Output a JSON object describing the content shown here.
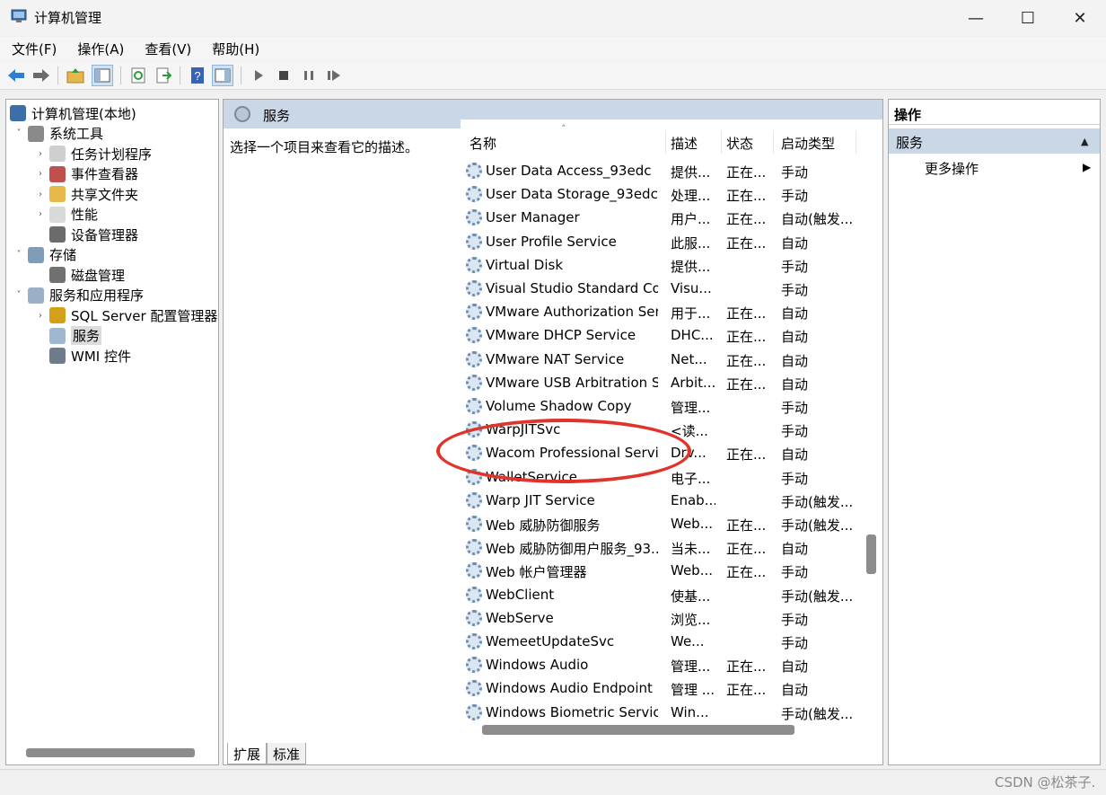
{
  "window": {
    "title": "计算机管理",
    "minimize_glyph": "—",
    "maximize_glyph": "☐",
    "close_glyph": "✕"
  },
  "menu": [
    "文件(F)",
    "操作(A)",
    "查看(V)",
    "帮助(H)"
  ],
  "toolbar": {
    "icons": [
      "back-arrow-icon",
      "forward-arrow-icon",
      "up-folder-icon",
      "show-hide-tree-icon",
      "refresh-icon",
      "export-list-icon",
      "help-icon",
      "properties-pane-icon",
      "start-service-icon",
      "stop-service-icon",
      "pause-service-icon",
      "restart-service-icon"
    ]
  },
  "tree": [
    {
      "label": "计算机管理(本地)",
      "level": 0,
      "expander": "",
      "icon": "computer-management-icon"
    },
    {
      "label": "系统工具",
      "level": 1,
      "expander": "˅",
      "icon": "system-tools-icon"
    },
    {
      "label": "任务计划程序",
      "level": 2,
      "expander": "›",
      "icon": "clock-icon"
    },
    {
      "label": "事件查看器",
      "level": 2,
      "expander": "›",
      "icon": "event-viewer-icon"
    },
    {
      "label": "共享文件夹",
      "level": 2,
      "expander": "›",
      "icon": "shared-folder-icon"
    },
    {
      "label": "性能",
      "level": 2,
      "expander": "›",
      "icon": "performance-icon"
    },
    {
      "label": "设备管理器",
      "level": 2,
      "expander": "",
      "icon": "device-manager-icon"
    },
    {
      "label": "存储",
      "level": 1,
      "expander": "˅",
      "icon": "storage-icon"
    },
    {
      "label": "磁盘管理",
      "level": 2,
      "expander": "",
      "icon": "disk-management-icon"
    },
    {
      "label": "服务和应用程序",
      "level": 1,
      "expander": "˅",
      "icon": "services-applications-icon"
    },
    {
      "label": "SQL Server 配置管理器",
      "level": 2,
      "expander": "›",
      "icon": "sql-server-icon"
    },
    {
      "label": "服务",
      "level": 2,
      "expander": "",
      "icon": "services-gear-icon",
      "selected": true
    },
    {
      "label": "WMI 控件",
      "level": 2,
      "expander": "",
      "icon": "wmi-control-icon"
    }
  ],
  "center": {
    "header": "服务",
    "description": "选择一个项目来查看它的描述。",
    "sort_glyph": "˄",
    "columns": {
      "name": "名称",
      "desc": "描述",
      "status": "状态",
      "startup": "启动类型"
    },
    "rows": [
      {
        "name": "User Data Access_93edc",
        "desc": "提供...",
        "status": "正在...",
        "startup": "手动"
      },
      {
        "name": "User Data Storage_93edc",
        "desc": "处理...",
        "status": "正在...",
        "startup": "手动"
      },
      {
        "name": "User Manager",
        "desc": "用户...",
        "status": "正在...",
        "startup": "自动(触发..."
      },
      {
        "name": "User Profile Service",
        "desc": "此服...",
        "status": "正在...",
        "startup": "自动"
      },
      {
        "name": "Virtual Disk",
        "desc": "提供...",
        "status": "",
        "startup": "手动"
      },
      {
        "name": "Visual Studio Standard Coll...",
        "desc": "Visu...",
        "status": "",
        "startup": "手动"
      },
      {
        "name": "VMware Authorization Ser...",
        "desc": "用于...",
        "status": "正在...",
        "startup": "自动"
      },
      {
        "name": "VMware DHCP Service",
        "desc": "DHC...",
        "status": "正在...",
        "startup": "自动"
      },
      {
        "name": "VMware NAT Service",
        "desc": "Net...",
        "status": "正在...",
        "startup": "自动"
      },
      {
        "name": "VMware USB Arbitration S...",
        "desc": "Arbit...",
        "status": "正在...",
        "startup": "自动"
      },
      {
        "name": "Volume Shadow Copy",
        "desc": "管理...",
        "status": "",
        "startup": "手动"
      },
      {
        "name": "WarpJITSvc",
        "desc": "<读...",
        "status": "",
        "startup": "手动"
      },
      {
        "name": "Wacom Professional Service",
        "desc": "Drv...",
        "status": "正在...",
        "startup": "自动"
      },
      {
        "name": "WalletService",
        "desc": "电子...",
        "status": "",
        "startup": "手动"
      },
      {
        "name": "Warp JIT Service",
        "desc": "Enab...",
        "status": "",
        "startup": "手动(触发..."
      },
      {
        "name": "Web 威胁防御服务",
        "desc": "Web...",
        "status": "正在...",
        "startup": "手动(触发..."
      },
      {
        "name": "Web 威胁防御用户服务_93...",
        "desc": "当未...",
        "status": "正在...",
        "startup": "自动"
      },
      {
        "name": "Web 帐户管理器",
        "desc": "Web...",
        "status": "正在...",
        "startup": "手动"
      },
      {
        "name": "WebClient",
        "desc": "使基...",
        "status": "",
        "startup": "手动(触发..."
      },
      {
        "name": "WebServe",
        "desc": "浏览...",
        "status": "",
        "startup": "手动"
      },
      {
        "name": "WemeetUpdateSvc",
        "desc": "We...",
        "status": "",
        "startup": "手动"
      },
      {
        "name": "Windows Audio",
        "desc": "管理...",
        "status": "正在...",
        "startup": "自动"
      },
      {
        "name": "Windows Audio Endpoint B...",
        "desc": "管理 ...",
        "status": "正在...",
        "startup": "自动"
      },
      {
        "name": "Windows Biometric Service",
        "desc": "Win...",
        "status": "",
        "startup": "手动(触发..."
      }
    ],
    "tabs": [
      "扩展",
      "标准"
    ],
    "vscroll_position": 0.68,
    "hscroll_position": 0.0
  },
  "actions": {
    "title": "操作",
    "group": "服务",
    "group_arrow": "▲",
    "more": "更多操作",
    "more_arrow": "▶"
  },
  "watermark": "CSDN @松茶子.",
  "colors": {
    "header_bg": "#c9d7e6",
    "annotation_red": "#e0342b",
    "gear_blue": "#6b8db0"
  }
}
